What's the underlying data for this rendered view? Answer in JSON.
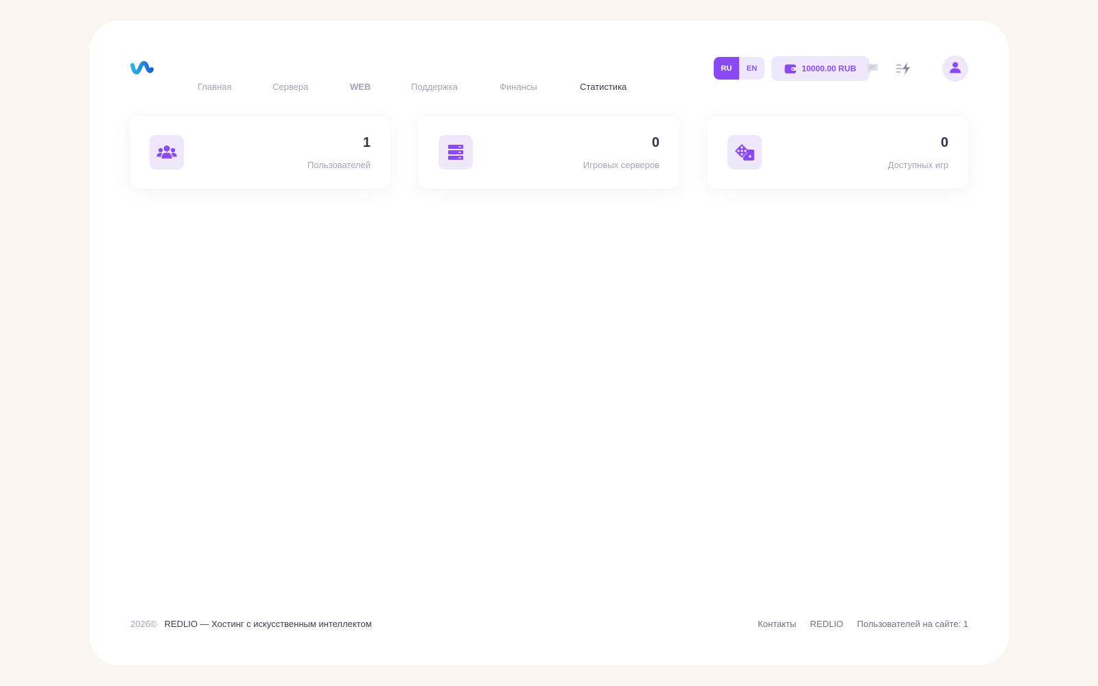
{
  "brand": {
    "logo_icon": "wave-logo-icon",
    "colors": {
      "blue": "#2aa6e0",
      "dark_blue": "#1f5fd6"
    }
  },
  "nav": {
    "items": [
      {
        "label": "Главная"
      },
      {
        "label": "Сервера"
      },
      {
        "label": "WEB"
      },
      {
        "label": "Поддержка"
      },
      {
        "label": "Финансы"
      },
      {
        "label": "Статистика",
        "active": true
      }
    ]
  },
  "lang": {
    "options": [
      "RU",
      "EN"
    ],
    "selected": "RU"
  },
  "balance": {
    "text": "10000.00 RUB",
    "icon": "wallet-icon"
  },
  "header_icons": {
    "chat": "chat-icon",
    "activity": "lightning-list-icon",
    "avatar": "user-icon"
  },
  "stats": [
    {
      "value": "1",
      "label": "Пользователей",
      "icon": "users-icon"
    },
    {
      "value": "0",
      "label": "Игровых серверов",
      "icon": "server-icon"
    },
    {
      "value": "0",
      "label": "Доступных игр",
      "icon": "dice-icon"
    }
  ],
  "footer": {
    "year": "2026©",
    "copyright": "REDLIO — Хостинг с искусственным интеллектом",
    "links": [
      "Контакты",
      "REDLIO"
    ],
    "online": "Пользователей на сайте: 1"
  },
  "colors": {
    "accent": "#8a4af3",
    "accent_light": "#efe8fd",
    "background": "#faf6ef",
    "muted_text": "#a4a3b8",
    "dark_text": "#3c3b52"
  }
}
